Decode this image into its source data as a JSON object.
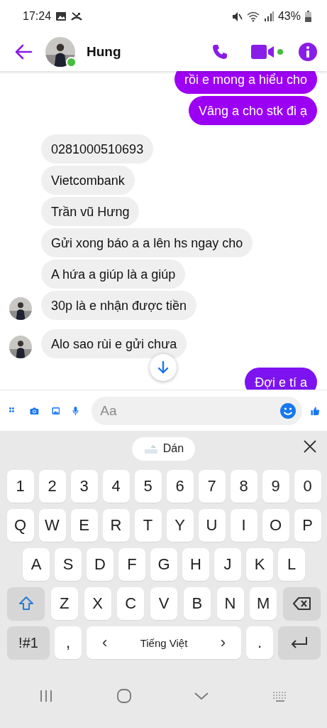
{
  "status_bar": {
    "time": "17:24",
    "battery": "43%"
  },
  "header": {
    "name": "Hung",
    "online": true,
    "video_active": true
  },
  "messages": [
    {
      "kind": "outgoing",
      "text": "rồi e mong a hiểu cho",
      "avatar": false
    },
    {
      "kind": "outgoing",
      "text": "Vâng a cho stk đi ạ",
      "avatar": false
    },
    {
      "kind": "incoming",
      "text": "0281000510693",
      "avatar": false
    },
    {
      "kind": "incoming",
      "text": "Vietcombank",
      "avatar": false
    },
    {
      "kind": "incoming",
      "text": "Trần vũ Hưng",
      "avatar": false
    },
    {
      "kind": "incoming",
      "text": "Gửi xong báo a a lên hs ngay cho",
      "avatar": false
    },
    {
      "kind": "incoming",
      "text": "A hứa a giúp là a giúp",
      "avatar": false
    },
    {
      "kind": "incoming",
      "text": "30p là e nhận được tiền",
      "avatar": true
    },
    {
      "kind": "incoming",
      "text": "Alo sao rùi e gửi chưa",
      "avatar": true
    },
    {
      "kind": "outgoing",
      "text": "Đợi e tí a",
      "avatar": false
    }
  ],
  "composer": {
    "placeholder": "Aa"
  },
  "keyboard": {
    "clipboard_label": "Dán",
    "rows": [
      [
        {
          "kind": "key",
          "label": "1"
        },
        {
          "kind": "key",
          "label": "2"
        },
        {
          "kind": "key",
          "label": "3"
        },
        {
          "kind": "key",
          "label": "4"
        },
        {
          "kind": "key",
          "label": "5"
        },
        {
          "kind": "key",
          "label": "6"
        },
        {
          "kind": "key",
          "label": "7"
        },
        {
          "kind": "key",
          "label": "8"
        },
        {
          "kind": "key",
          "label": "9"
        },
        {
          "kind": "key",
          "label": "0"
        }
      ],
      [
        {
          "kind": "key",
          "label": "Q"
        },
        {
          "kind": "key",
          "label": "W"
        },
        {
          "kind": "key",
          "label": "E"
        },
        {
          "kind": "key",
          "label": "R"
        },
        {
          "kind": "key",
          "label": "T"
        },
        {
          "kind": "key",
          "label": "Y"
        },
        {
          "kind": "key",
          "label": "U"
        },
        {
          "kind": "key",
          "label": "I"
        },
        {
          "kind": "key",
          "label": "O"
        },
        {
          "kind": "key",
          "label": "P"
        }
      ],
      [
        {
          "kind": "key",
          "label": "A"
        },
        {
          "kind": "key",
          "label": "S"
        },
        {
          "kind": "key",
          "label": "D"
        },
        {
          "kind": "key",
          "label": "F"
        },
        {
          "kind": "key",
          "label": "G"
        },
        {
          "kind": "key",
          "label": "H"
        },
        {
          "kind": "key",
          "label": "J"
        },
        {
          "kind": "key",
          "label": "K"
        },
        {
          "kind": "key",
          "label": "L"
        }
      ],
      [
        {
          "kind": "shift"
        },
        {
          "kind": "key",
          "label": "Z"
        },
        {
          "kind": "key",
          "label": "X"
        },
        {
          "kind": "key",
          "label": "C"
        },
        {
          "kind": "key",
          "label": "V"
        },
        {
          "kind": "key",
          "label": "B"
        },
        {
          "kind": "key",
          "label": "N"
        },
        {
          "kind": "key",
          "label": "M"
        },
        {
          "kind": "backspace"
        }
      ],
      [
        {
          "kind": "symbols",
          "label": "!#1"
        },
        {
          "kind": "key",
          "label": ","
        },
        {
          "kind": "space",
          "label": "Tiếng Việt",
          "left": "‹",
          "right": "›"
        },
        {
          "kind": "key",
          "label": "."
        },
        {
          "kind": "enter"
        }
      ]
    ]
  }
}
